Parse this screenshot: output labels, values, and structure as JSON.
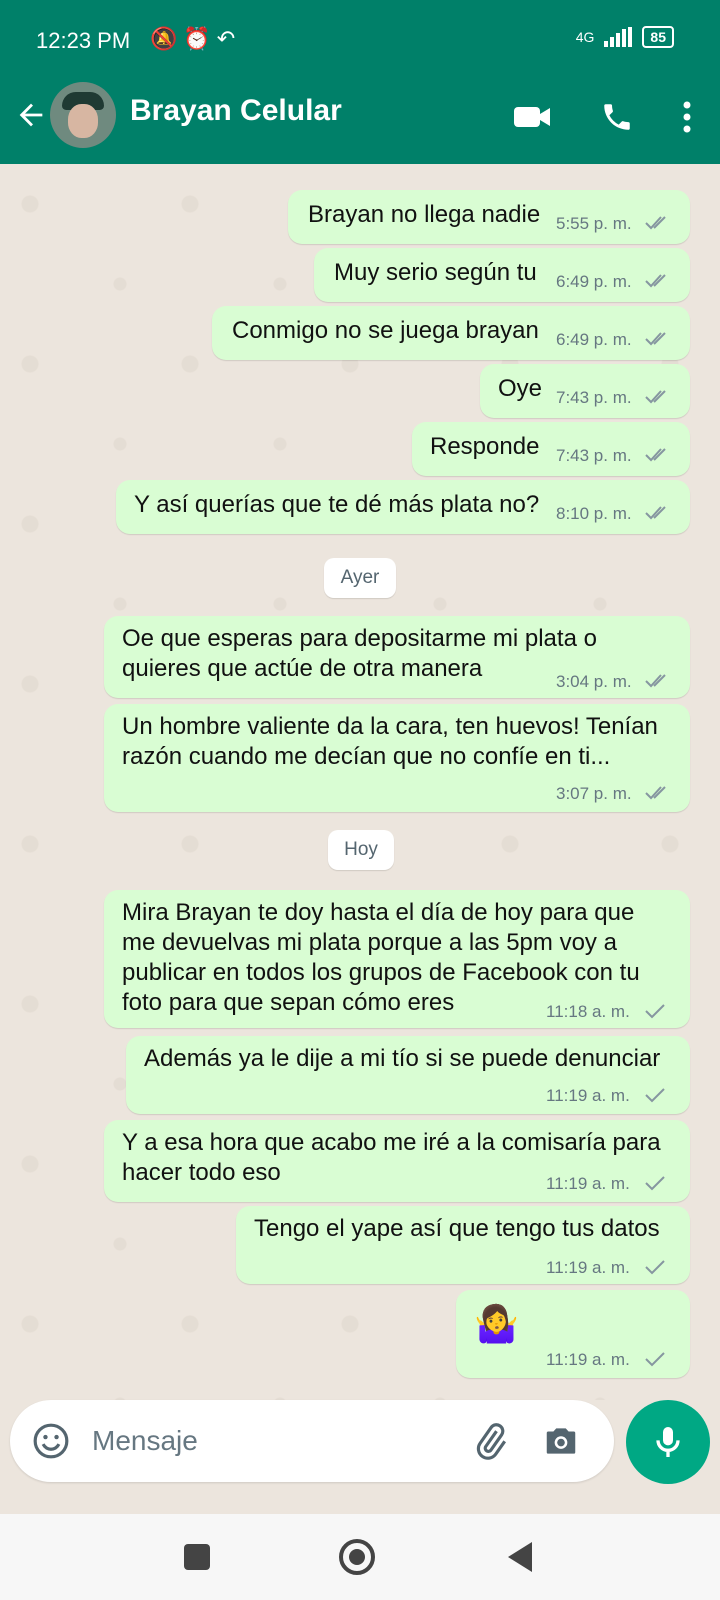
{
  "status_bar": {
    "time": "12:23 PM",
    "network": "4G",
    "battery": "85"
  },
  "header": {
    "title": "Brayan Celular"
  },
  "date_separators": [
    "Ayer",
    "Hoy"
  ],
  "messages": [
    {
      "text": "Brayan no llega nadie",
      "time": "5:55 p. m.",
      "status": "read"
    },
    {
      "text": "Muy serio según tu",
      "time": "6:49 p. m.",
      "status": "read"
    },
    {
      "text": "Conmigo no se juega brayan",
      "time": "6:49 p. m.",
      "status": "read"
    },
    {
      "text": "Oye",
      "time": "7:43 p. m.",
      "status": "read"
    },
    {
      "text": "Responde",
      "time": "7:43 p. m.",
      "status": "read"
    },
    {
      "text": "Y así querías que te dé más plata no?",
      "time": "8:10 p. m.",
      "status": "read"
    },
    {
      "text": "Oe que esperas para depositarme mi plata o quieres que actúe de otra manera",
      "time": "3:04 p. m.",
      "status": "read"
    },
    {
      "text": "Un hombre valiente da la cara, ten huevos! Tenían razón cuando me decían que no confíe en ti...",
      "time": "3:07 p. m.",
      "status": "read"
    },
    {
      "text": "Mira Brayan te doy hasta el día de hoy para que me devuelvas mi plata porque a las 5pm voy a publicar en todos los grupos de Facebook con tu foto para que sepan cómo eres",
      "time": "11:18 a. m.",
      "status": "sent"
    },
    {
      "text": "Además ya le dije a mi tío si se puede denunciar",
      "time": "11:19 a. m.",
      "status": "sent"
    },
    {
      "text": "Y a esa hora que acabo me iré a la comisaría para hacer todo eso",
      "time": "11:19 a. m.",
      "status": "sent"
    },
    {
      "text": "Tengo el yape así que tengo tus datos",
      "time": "11:19 a. m.",
      "status": "sent"
    },
    {
      "text": "🤷‍♀️",
      "time": "11:19 a. m.",
      "status": "sent"
    }
  ],
  "composer": {
    "placeholder": "Mensaje"
  },
  "colors": {
    "header": "#008069",
    "bubble_out": "#d9fdd3",
    "mic_button": "#00a884",
    "chat_bg": "#ece5dd"
  },
  "icons": [
    "back-arrow-icon",
    "video-call-icon",
    "phone-icon",
    "more-options-icon",
    "emoji-icon",
    "attach-icon",
    "camera-icon",
    "mic-icon"
  ]
}
